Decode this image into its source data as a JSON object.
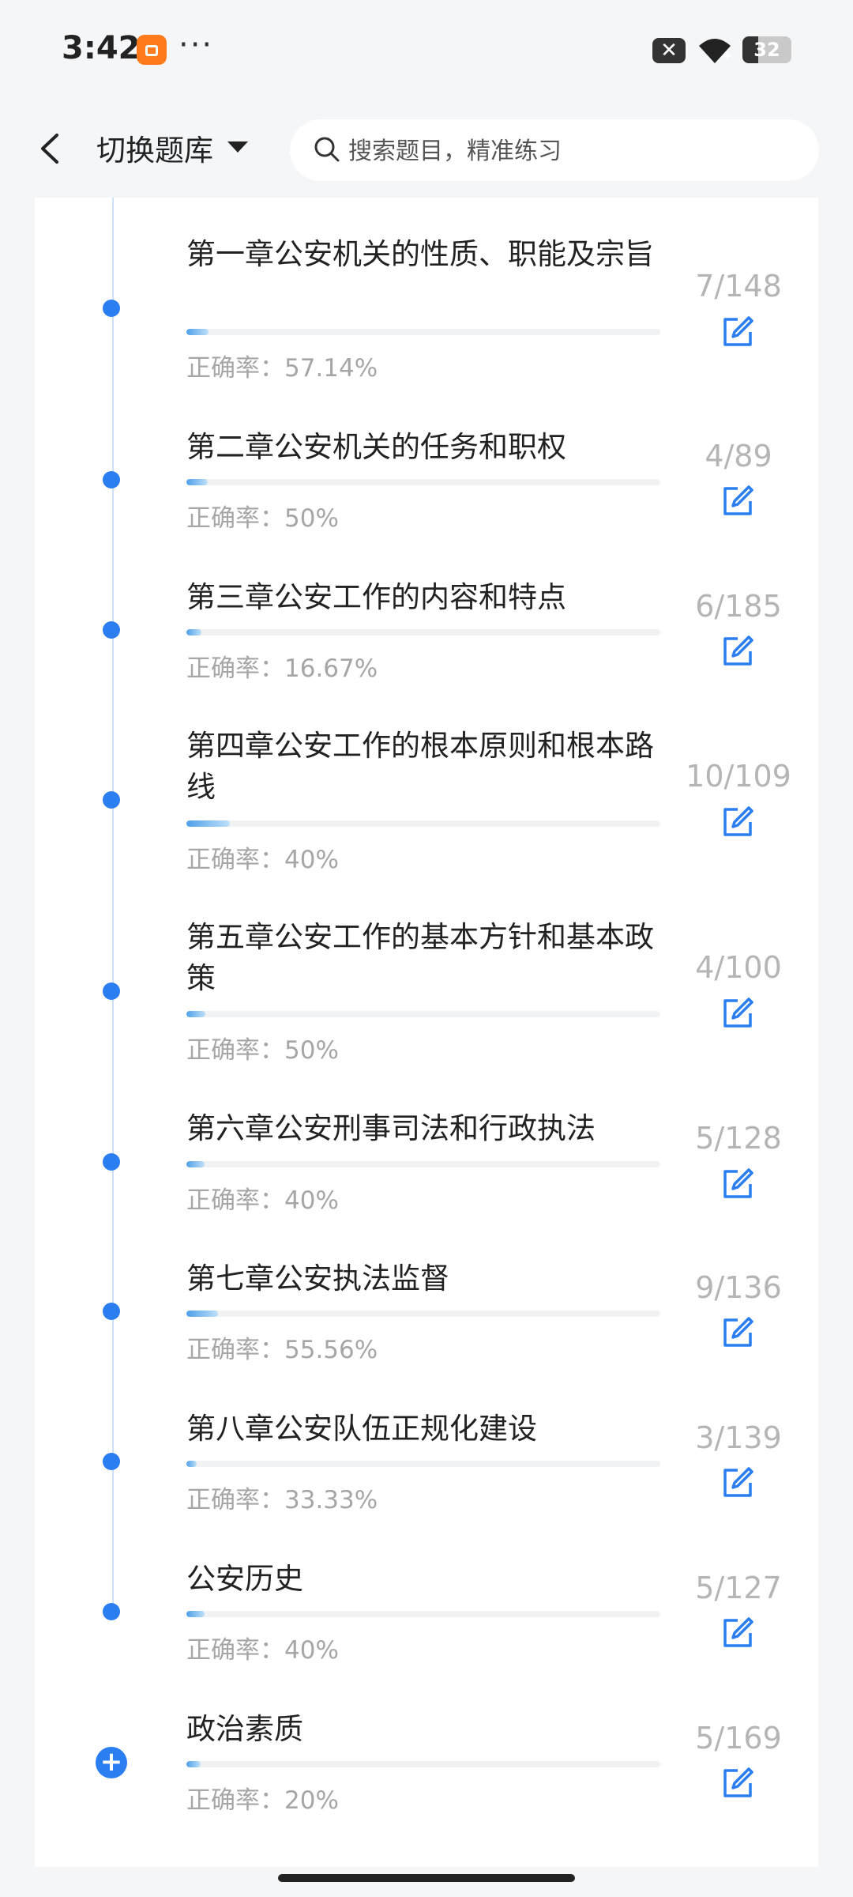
{
  "status_bar": {
    "time": "3:42",
    "dots": "···",
    "battery_level": "32",
    "battery_fraction": 0.32
  },
  "header": {
    "switch_label": "切换题库",
    "search_placeholder": "搜索题目，精准练习"
  },
  "chapters": [
    {
      "title": "第一章公安机关的性质、职能及宗旨",
      "accuracy": "正确率：57.14%",
      "count": "7/148",
      "progress": 0.047
    },
    {
      "title": "第二章公安机关的任务和职权",
      "accuracy": "正确率：50%",
      "count": "4/89",
      "progress": 0.045
    },
    {
      "title": "第三章公安工作的内容和特点",
      "accuracy": "正确率：16.67%",
      "count": "6/185",
      "progress": 0.032
    },
    {
      "title": "第四章公安工作的根本原则和根本路线",
      "accuracy": "正确率：40%",
      "count": "10/109",
      "progress": 0.092
    },
    {
      "title": "第五章公安工作的基本方针和基本政策",
      "accuracy": "正确率：50%",
      "count": "4/100",
      "progress": 0.04
    },
    {
      "title": "第六章公安刑事司法和行政执法",
      "accuracy": "正确率：40%",
      "count": "5/128",
      "progress": 0.039
    },
    {
      "title": "第七章公安执法监督",
      "accuracy": "正确率：55.56%",
      "count": "9/136",
      "progress": 0.066
    },
    {
      "title": "第八章公安队伍正规化建设",
      "accuracy": "正确率：33.33%",
      "count": "3/139",
      "progress": 0.022
    },
    {
      "title": "公安历史",
      "accuracy": "正确率：40%",
      "count": "5/127",
      "progress": 0.039
    },
    {
      "title": "政治素质",
      "accuracy": "正确率：20%",
      "count": "5/169",
      "progress": 0.03
    }
  ],
  "colors": {
    "accent": "#2b7ef0",
    "muted_text": "#a6a6a6",
    "count_text": "#b5b5b5"
  },
  "icons": {
    "back": "chevron-left-icon",
    "caret": "caret-down-icon",
    "search": "search-icon",
    "edit": "edit-icon",
    "timeline_dot": "timeline-dot-icon",
    "expand": "plus-circle-icon"
  }
}
